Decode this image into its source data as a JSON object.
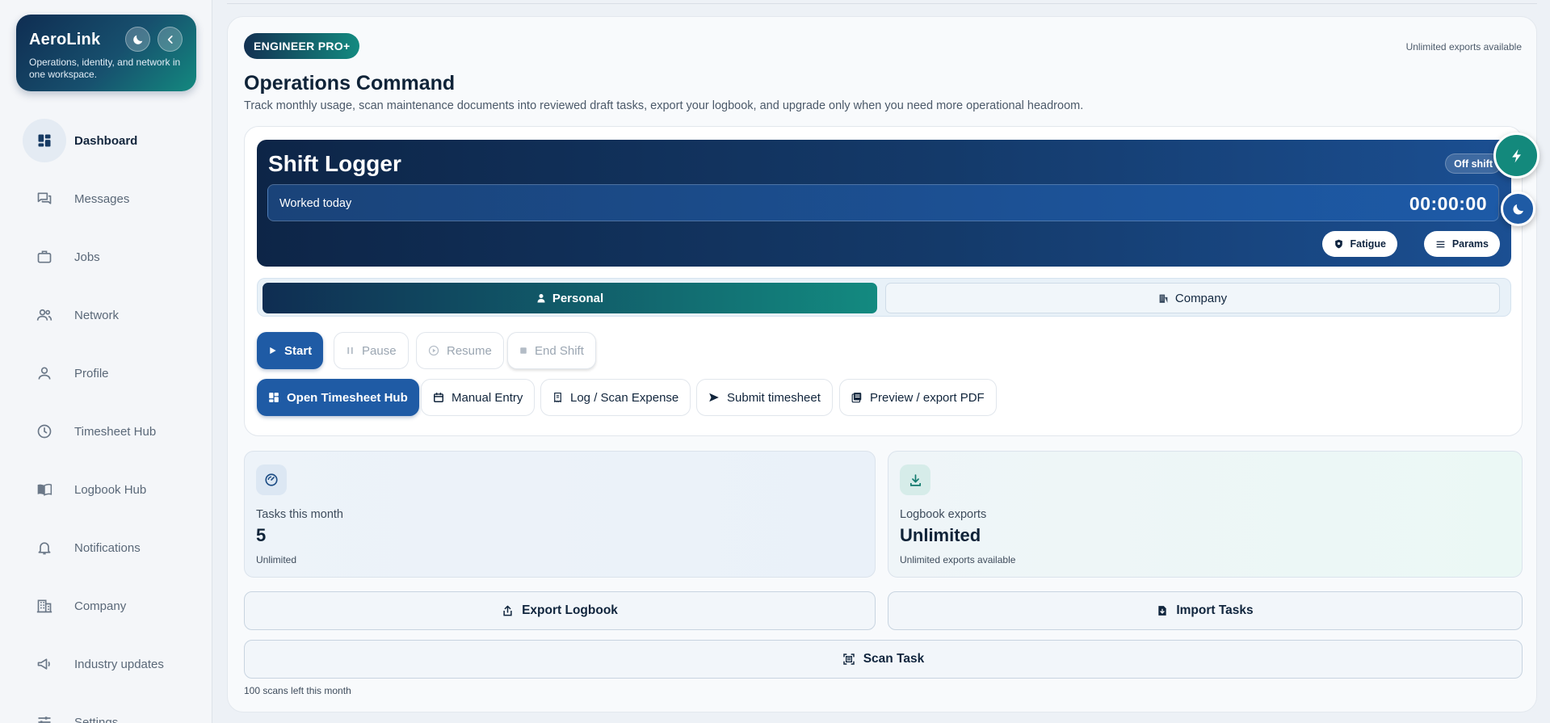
{
  "brand": {
    "title": "AeroLink",
    "subtitle": "Operations, identity, and network in one workspace."
  },
  "nav": {
    "items": [
      {
        "label": "Dashboard",
        "icon": "dashboard-icon",
        "active": true
      },
      {
        "label": "Messages",
        "icon": "messages-icon"
      },
      {
        "label": "Jobs",
        "icon": "briefcase-icon"
      },
      {
        "label": "Network",
        "icon": "people-icon"
      },
      {
        "label": "Profile",
        "icon": "person-icon"
      },
      {
        "label": "Timesheet Hub",
        "icon": "clock-icon"
      },
      {
        "label": "Logbook Hub",
        "icon": "book-icon"
      },
      {
        "label": "Notifications",
        "icon": "bell-icon"
      },
      {
        "label": "Company",
        "icon": "building-icon"
      },
      {
        "label": "Industry updates",
        "icon": "megaphone-icon"
      },
      {
        "label": "Settings",
        "icon": "sliders-icon"
      }
    ]
  },
  "header": {
    "plan_badge": "ENGINEER PRO+",
    "top_note": "Unlimited exports available",
    "title": "Operations Command",
    "subtitle": "Track monthly usage, scan maintenance documents into reviewed draft tasks, export your logbook, and upgrade only when you need more operational headroom."
  },
  "logger": {
    "title": "Shift Logger",
    "status": "Off shift",
    "worked_label": "Worked today",
    "worked_time": "00:00:00",
    "chips": {
      "fatigue": "Fatigue",
      "params": "Params"
    },
    "modes": {
      "personal": "Personal",
      "company": "Company",
      "selected": "Personal"
    },
    "controls": {
      "start": "Start",
      "pause": "Pause",
      "resume": "Resume",
      "end": "End Shift"
    },
    "actions": {
      "timesheet_hub": "Open Timesheet Hub",
      "manual_entry": "Manual Entry",
      "log_expense": "Log / Scan Expense",
      "submit": "Submit timesheet",
      "preview": "Preview / export PDF"
    }
  },
  "stats": {
    "tasks": {
      "label": "Tasks this month",
      "value": "5",
      "note": "Unlimited"
    },
    "exports": {
      "label": "Logbook exports",
      "value": "Unlimited",
      "note": "Unlimited exports available"
    }
  },
  "bottom": {
    "export_label": "Export Logbook",
    "import_label": "Import Tasks",
    "scan_label": "Scan Task",
    "scan_note": "100 scans left this month"
  },
  "colors": {
    "navy": "#0f2d52",
    "teal": "#138a80",
    "primary_blue": "#1f5ba5"
  }
}
